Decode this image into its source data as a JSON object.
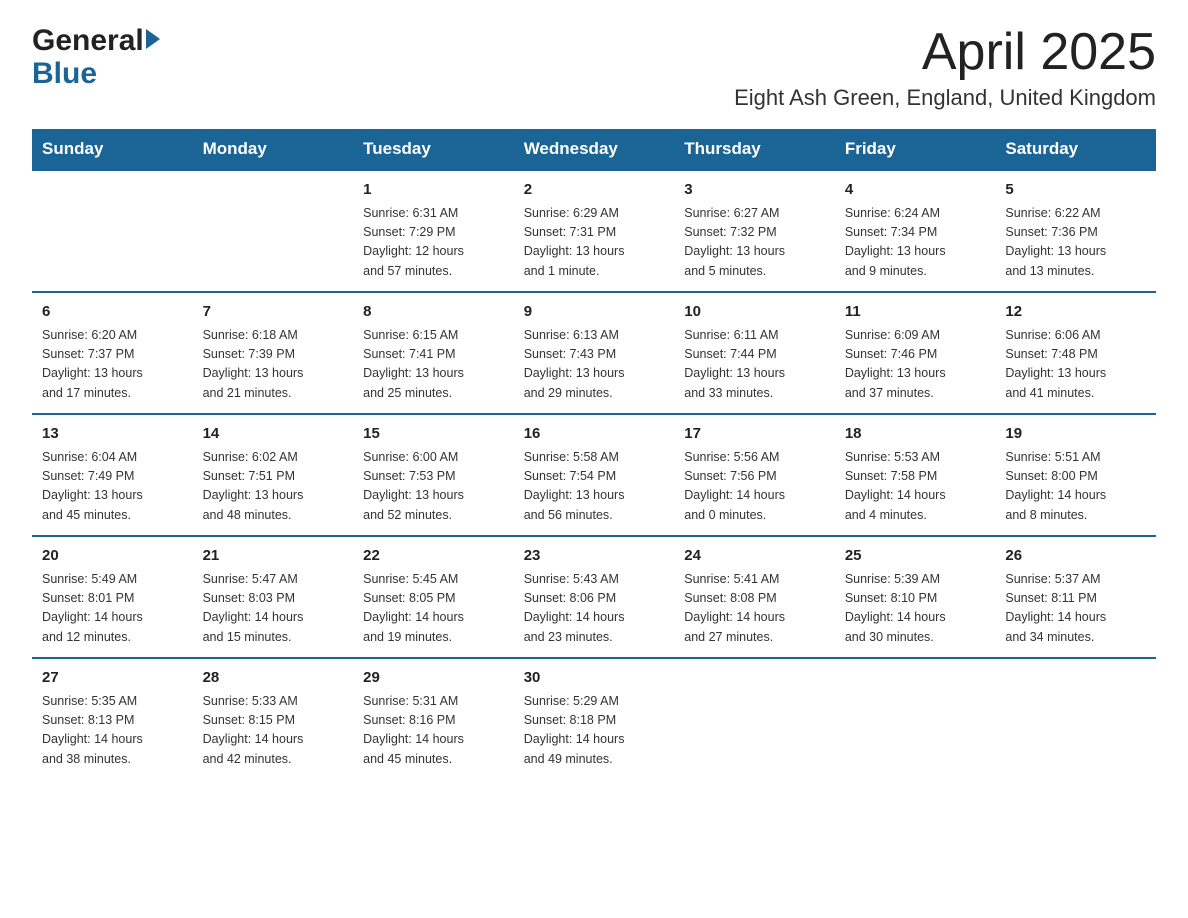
{
  "logo": {
    "general": "General",
    "blue": "Blue"
  },
  "title": {
    "month_year": "April 2025",
    "location": "Eight Ash Green, England, United Kingdom"
  },
  "days_of_week": [
    "Sunday",
    "Monday",
    "Tuesday",
    "Wednesday",
    "Thursday",
    "Friday",
    "Saturday"
  ],
  "weeks": [
    [
      {
        "day": "",
        "info": ""
      },
      {
        "day": "",
        "info": ""
      },
      {
        "day": "1",
        "info": "Sunrise: 6:31 AM\nSunset: 7:29 PM\nDaylight: 12 hours\nand 57 minutes."
      },
      {
        "day": "2",
        "info": "Sunrise: 6:29 AM\nSunset: 7:31 PM\nDaylight: 13 hours\nand 1 minute."
      },
      {
        "day": "3",
        "info": "Sunrise: 6:27 AM\nSunset: 7:32 PM\nDaylight: 13 hours\nand 5 minutes."
      },
      {
        "day": "4",
        "info": "Sunrise: 6:24 AM\nSunset: 7:34 PM\nDaylight: 13 hours\nand 9 minutes."
      },
      {
        "day": "5",
        "info": "Sunrise: 6:22 AM\nSunset: 7:36 PM\nDaylight: 13 hours\nand 13 minutes."
      }
    ],
    [
      {
        "day": "6",
        "info": "Sunrise: 6:20 AM\nSunset: 7:37 PM\nDaylight: 13 hours\nand 17 minutes."
      },
      {
        "day": "7",
        "info": "Sunrise: 6:18 AM\nSunset: 7:39 PM\nDaylight: 13 hours\nand 21 minutes."
      },
      {
        "day": "8",
        "info": "Sunrise: 6:15 AM\nSunset: 7:41 PM\nDaylight: 13 hours\nand 25 minutes."
      },
      {
        "day": "9",
        "info": "Sunrise: 6:13 AM\nSunset: 7:43 PM\nDaylight: 13 hours\nand 29 minutes."
      },
      {
        "day": "10",
        "info": "Sunrise: 6:11 AM\nSunset: 7:44 PM\nDaylight: 13 hours\nand 33 minutes."
      },
      {
        "day": "11",
        "info": "Sunrise: 6:09 AM\nSunset: 7:46 PM\nDaylight: 13 hours\nand 37 minutes."
      },
      {
        "day": "12",
        "info": "Sunrise: 6:06 AM\nSunset: 7:48 PM\nDaylight: 13 hours\nand 41 minutes."
      }
    ],
    [
      {
        "day": "13",
        "info": "Sunrise: 6:04 AM\nSunset: 7:49 PM\nDaylight: 13 hours\nand 45 minutes."
      },
      {
        "day": "14",
        "info": "Sunrise: 6:02 AM\nSunset: 7:51 PM\nDaylight: 13 hours\nand 48 minutes."
      },
      {
        "day": "15",
        "info": "Sunrise: 6:00 AM\nSunset: 7:53 PM\nDaylight: 13 hours\nand 52 minutes."
      },
      {
        "day": "16",
        "info": "Sunrise: 5:58 AM\nSunset: 7:54 PM\nDaylight: 13 hours\nand 56 minutes."
      },
      {
        "day": "17",
        "info": "Sunrise: 5:56 AM\nSunset: 7:56 PM\nDaylight: 14 hours\nand 0 minutes."
      },
      {
        "day": "18",
        "info": "Sunrise: 5:53 AM\nSunset: 7:58 PM\nDaylight: 14 hours\nand 4 minutes."
      },
      {
        "day": "19",
        "info": "Sunrise: 5:51 AM\nSunset: 8:00 PM\nDaylight: 14 hours\nand 8 minutes."
      }
    ],
    [
      {
        "day": "20",
        "info": "Sunrise: 5:49 AM\nSunset: 8:01 PM\nDaylight: 14 hours\nand 12 minutes."
      },
      {
        "day": "21",
        "info": "Sunrise: 5:47 AM\nSunset: 8:03 PM\nDaylight: 14 hours\nand 15 minutes."
      },
      {
        "day": "22",
        "info": "Sunrise: 5:45 AM\nSunset: 8:05 PM\nDaylight: 14 hours\nand 19 minutes."
      },
      {
        "day": "23",
        "info": "Sunrise: 5:43 AM\nSunset: 8:06 PM\nDaylight: 14 hours\nand 23 minutes."
      },
      {
        "day": "24",
        "info": "Sunrise: 5:41 AM\nSunset: 8:08 PM\nDaylight: 14 hours\nand 27 minutes."
      },
      {
        "day": "25",
        "info": "Sunrise: 5:39 AM\nSunset: 8:10 PM\nDaylight: 14 hours\nand 30 minutes."
      },
      {
        "day": "26",
        "info": "Sunrise: 5:37 AM\nSunset: 8:11 PM\nDaylight: 14 hours\nand 34 minutes."
      }
    ],
    [
      {
        "day": "27",
        "info": "Sunrise: 5:35 AM\nSunset: 8:13 PM\nDaylight: 14 hours\nand 38 minutes."
      },
      {
        "day": "28",
        "info": "Sunrise: 5:33 AM\nSunset: 8:15 PM\nDaylight: 14 hours\nand 42 minutes."
      },
      {
        "day": "29",
        "info": "Sunrise: 5:31 AM\nSunset: 8:16 PM\nDaylight: 14 hours\nand 45 minutes."
      },
      {
        "day": "30",
        "info": "Sunrise: 5:29 AM\nSunset: 8:18 PM\nDaylight: 14 hours\nand 49 minutes."
      },
      {
        "day": "",
        "info": ""
      },
      {
        "day": "",
        "info": ""
      },
      {
        "day": "",
        "info": ""
      }
    ]
  ]
}
